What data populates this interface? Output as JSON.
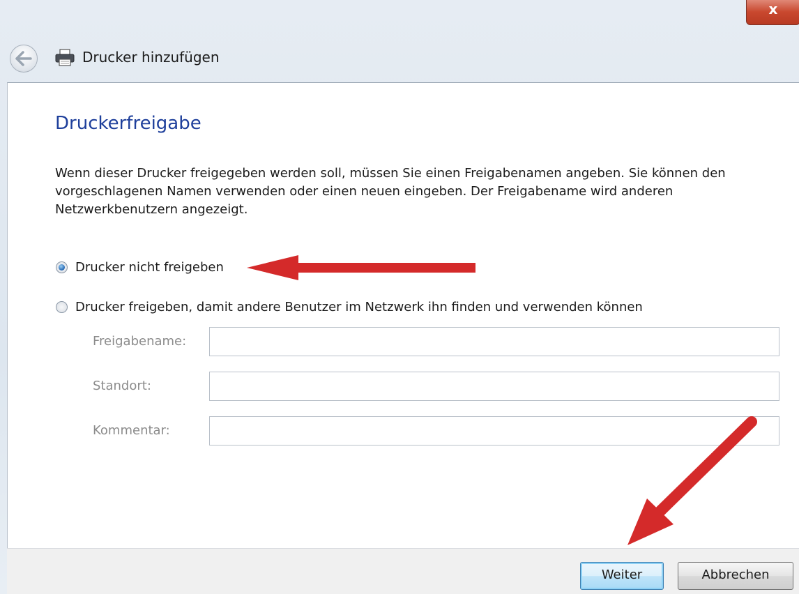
{
  "window": {
    "title": "Drucker hinzufügen",
    "close_glyph": "x"
  },
  "page": {
    "heading": "Druckerfreigabe",
    "description": "Wenn dieser Drucker freigegeben werden soll, müssen Sie einen Freigabenamen angeben. Sie können den vorgeschlagenen Namen verwenden oder einen neuen eingeben. Der Freigabename wird anderen Netzwerkbenutzern angezeigt."
  },
  "options": [
    {
      "label": "Drucker nicht freigeben",
      "selected": true
    },
    {
      "label": "Drucker freigeben, damit andere Benutzer im Netzwerk ihn finden und verwenden können",
      "selected": false
    }
  ],
  "fields": [
    {
      "label": "Freigabename:",
      "value": "",
      "enabled": false
    },
    {
      "label": "Standort:",
      "value": "",
      "enabled": false
    },
    {
      "label": "Kommentar:",
      "value": "",
      "enabled": false
    }
  ],
  "buttons": {
    "next": "Weiter",
    "cancel": "Abbrechen"
  },
  "icons": {
    "back": "back-arrow-icon",
    "printer": "printer-icon",
    "annotation": "red-arrow"
  },
  "colors": {
    "heading": "#1e3f9b",
    "annotation_arrow": "#d42a2a"
  }
}
